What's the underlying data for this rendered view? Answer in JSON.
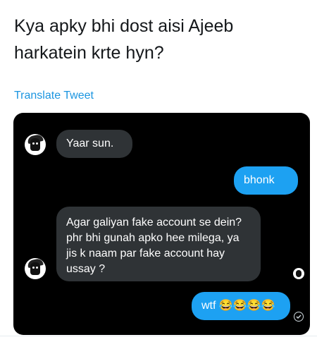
{
  "tweet": {
    "text": "Kya apky bhi dost aisi Ajeeb harkatein krte hyn?",
    "translate_label": "Translate Tweet"
  },
  "conversation": {
    "messages": [
      {
        "sender": "friend",
        "text": "Yaar sun."
      },
      {
        "sender": "me",
        "text": "bhonk"
      },
      {
        "sender": "friend",
        "text": "Agar galiyan fake account se dein? phr bhi gunah apko hee milega, ya jis k naam par fake account hay ussay ?"
      },
      {
        "sender": "me",
        "text": "wtf 😂😂😂😂"
      }
    ]
  },
  "icons": {
    "avatar": "avatar-icon",
    "seen_avatar": "seen-avatar-icon",
    "delivered": "check-circle-icon"
  },
  "colors": {
    "card_background": "#000000",
    "incoming_bubble": "#2f3336",
    "outgoing_bubble": "#1da1f2",
    "link": "#1b95e0"
  }
}
